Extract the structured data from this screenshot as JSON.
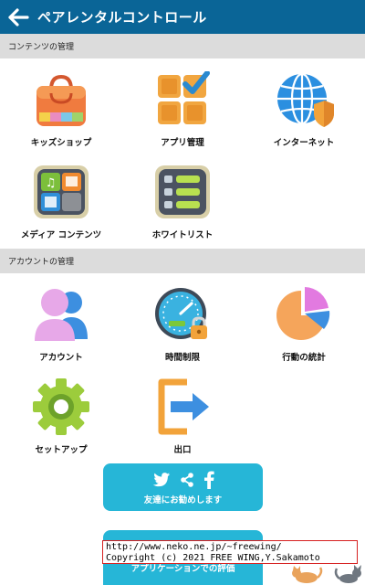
{
  "appbar": {
    "title": "ペアレンタルコントロール"
  },
  "sections": {
    "content": {
      "title": "コンテンツの管理"
    },
    "account": {
      "title": "アカウントの管理"
    }
  },
  "tiles": {
    "kids_shop": {
      "label": "キッズショップ",
      "icon": "shopping-bag-icon"
    },
    "app_manage": {
      "label": "アプリ管理",
      "icon": "app-grid-check-icon"
    },
    "internet": {
      "label": "インターネット",
      "icon": "globe-shield-icon"
    },
    "media": {
      "label": "メディア コンテンツ",
      "icon": "media-grid-icon"
    },
    "whitelist": {
      "label": "ホワイトリスト",
      "icon": "list-icon"
    },
    "account": {
      "label": "アカウント",
      "icon": "users-icon"
    },
    "time_limit": {
      "label": "時間制限",
      "icon": "timer-lock-icon"
    },
    "stats": {
      "label": "行動の統計",
      "icon": "pie-chart-icon"
    },
    "setup": {
      "label": "セットアップ",
      "icon": "gear-icon"
    },
    "exit": {
      "label": "出口",
      "icon": "exit-icon"
    }
  },
  "share": {
    "label": "友達にお勧めします",
    "icons": [
      "twitter-icon",
      "share-icon",
      "facebook-icon"
    ]
  },
  "review": {
    "label": "アプリケーションでの評価"
  },
  "watermark": {
    "line1": "http://www.neko.ne.jp/~freewing/",
    "line2": "Copyright (c) 2021 FREE WING,Y.Sakamoto"
  },
  "colors": {
    "appbar": "#0a6597",
    "section_header": "#dcdcdc",
    "button": "#26b6d7"
  }
}
